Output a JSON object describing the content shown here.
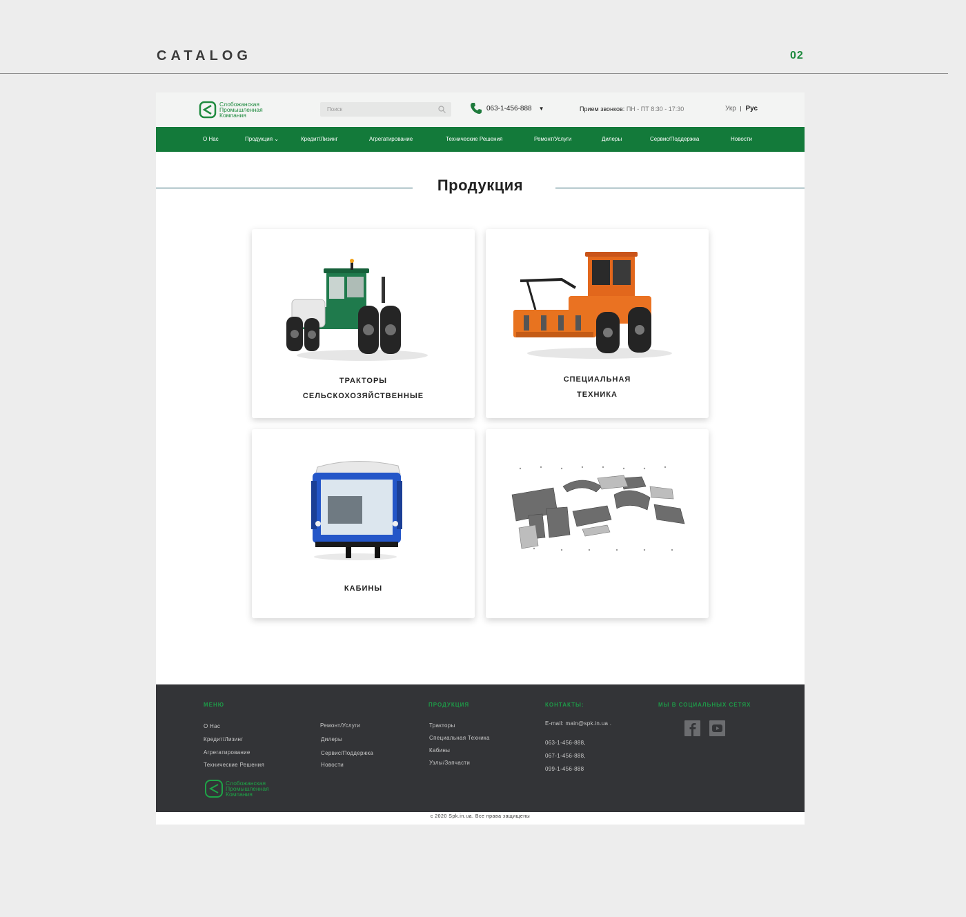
{
  "presentation": {
    "title": "CATALOG",
    "number": "02"
  },
  "header": {
    "logo_lines": [
      "Слобожанская",
      "Промышленная",
      "Компания"
    ],
    "search_placeholder": "Поиск",
    "phone": "063-1-456-888",
    "hours_label": "Прием звонков:",
    "hours_value": "ПН - ПТ  8:30 - 17:30",
    "lang_ua": "Укр",
    "lang_separator": "|",
    "lang_ru": "Рус"
  },
  "nav": {
    "items": [
      "О Нас",
      "Продукция ⌄",
      "Кредит/Лизинг",
      "Агрегатирование",
      "Технические Решения",
      "Ремонт/Услуги",
      "Дилеры",
      "Сервис/Поддержка",
      "Новости"
    ]
  },
  "main": {
    "heading": "Продукция",
    "cards": [
      {
        "line1": "ТРАКТОРЫ",
        "line2": "СЕЛЬСКОХОЗЯЙСТВЕННЫЕ",
        "image": "green-tractor-icon"
      },
      {
        "line1": "СПЕЦИАЛЬНАЯ",
        "line2": "ТЕХНИКА",
        "image": "orange-tractor-mulcher-icon"
      },
      {
        "line1": "КАБИНЫ",
        "line2": "",
        "image": "blue-cabin-icon"
      },
      {
        "line1": "",
        "line2": "",
        "image": "exploded-parts-icon"
      }
    ]
  },
  "footer": {
    "menu_heading": "МЕНЮ",
    "menu_col1": [
      "О Нас",
      "Кредит/Лизинг",
      "Агрегатирование",
      "Технические Решения"
    ],
    "menu_col2": [
      "Ремонт/Услуги",
      "Дилеры",
      "Сервис/Поддержка",
      "Новости"
    ],
    "products_heading": "ПРОДУКЦИЯ",
    "products": [
      "Тракторы",
      "Специальная Техника",
      "Кабины",
      "Узлы/Запчасти"
    ],
    "contacts_heading": "КОНТАКТЫ:",
    "email": "E-mail:  main@spk.in.ua .",
    "phones": [
      "063-1-456-888,",
      "067-1-456-888,",
      "099-1-456-888"
    ],
    "social_heading": "МЫ В СОЦИАЛЬНЫХ СЕТЯХ",
    "social_icons": [
      "facebook-icon",
      "youtube-icon"
    ],
    "logo_lines": [
      "Слобожанская",
      "Промышленная",
      "Компания"
    ]
  },
  "copyright": "с 2020 Spk.in.ua. Все права защищены",
  "colors": {
    "brand_green": "#137a3a",
    "footer_bg": "#333437",
    "accent_green": "#1e9a48"
  }
}
